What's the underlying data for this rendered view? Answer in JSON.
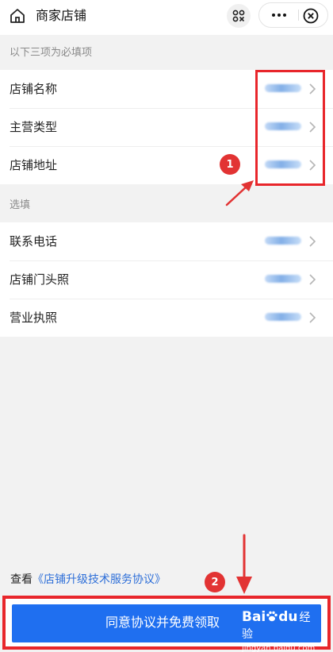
{
  "titlebar": {
    "title": "商家店铺",
    "home_icon": "home-icon",
    "scan_icon": "scan-icon",
    "more_icon": "more-dots-icon",
    "close_icon": "close-circle-icon"
  },
  "required_section": {
    "label": "以下三项为必填项",
    "items": [
      {
        "label": "店铺名称"
      },
      {
        "label": "主营类型"
      },
      {
        "label": "店铺地址"
      }
    ]
  },
  "optional_section": {
    "label": "选填",
    "items": [
      {
        "label": "联系电话"
      },
      {
        "label": "店铺门头照"
      },
      {
        "label": "营业执照"
      }
    ]
  },
  "annotations": {
    "badge_1": "1",
    "badge_2": "2",
    "color": "#e8262b"
  },
  "agreement": {
    "prefix": "查看",
    "link": "《店铺升级技术服务协议》"
  },
  "submit_button": {
    "label": "同意协议并免费领取"
  },
  "watermark": {
    "brand": "Bai",
    "brand_suffix": "du",
    "jingyan": "经验",
    "url": "jingyan.baidu.com"
  },
  "colors": {
    "primary": "#1f6ff0",
    "link": "#2e6fd8",
    "annotation_red": "#e8262b"
  }
}
